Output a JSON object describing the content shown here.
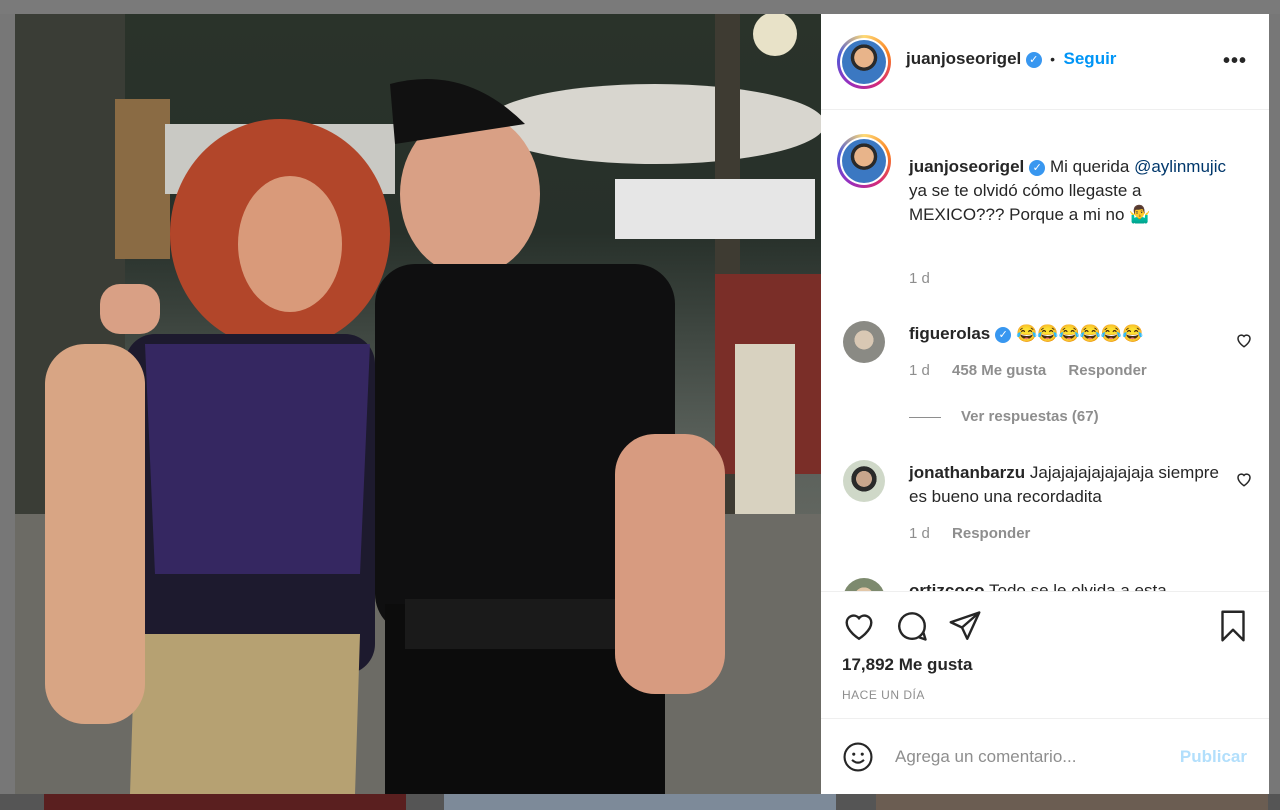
{
  "colors": {
    "accent": "#0095f6",
    "verified": "#3897f0",
    "text": "#262626",
    "muted": "#8e8e8e",
    "publish_disabled": "#b2dffc"
  },
  "post": {
    "author": "juanjoseorigel",
    "follow_label": "Seguir",
    "follow_separator": "•",
    "more_icon": "more-horizontal-icon"
  },
  "caption": {
    "author": "juanjoseorigel",
    "text_before": " Mi querida ",
    "mention": "@aylinmujic",
    "text_after": " ya se te olvidó cómo llegaste a MEXICO??? Porque a mi no 🤷‍♂️",
    "time": "1 d"
  },
  "comments": [
    {
      "author": "figuerolas",
      "verified": true,
      "text": "😂😂😂😂😂😂",
      "time": "1 d",
      "likes": "458 Me gusta",
      "reply": "Responder",
      "view_replies": "Ver respuestas (67)"
    },
    {
      "author": "jonathanbarzu",
      "verified": false,
      "text": "Jajajajajajajajaja siempre es bueno una recordadita",
      "time": "1 d",
      "reply": "Responder"
    },
    {
      "author": "ortizcoco",
      "verified": false,
      "text": "Todo se le olvida a esta"
    }
  ],
  "actions": {
    "like_icon": "heart-icon",
    "comment_icon": "comment-icon",
    "share_icon": "send-icon",
    "save_icon": "bookmark-icon",
    "likes": "17,892 Me gusta",
    "posted": "HACE UN DÍA"
  },
  "add_comment": {
    "emoji_icon": "emoji-icon",
    "placeholder": "Agrega un comentario...",
    "publish_label": "Publicar"
  }
}
